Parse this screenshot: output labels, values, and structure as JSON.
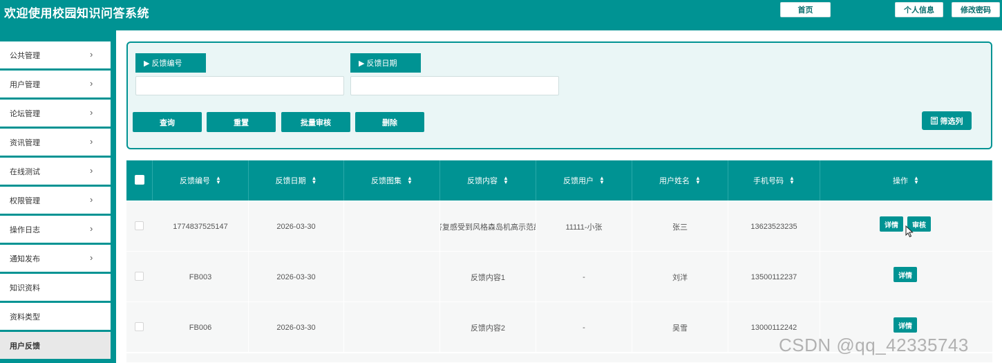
{
  "header": {
    "title": "欢迎使用校园知识问答系统",
    "home_label": "首页",
    "profile_label": "个人信息",
    "password_label": "修改密码"
  },
  "sidebar": {
    "items": [
      {
        "label": "公共管理",
        "has_arrow": true
      },
      {
        "label": "用户管理",
        "has_arrow": true
      },
      {
        "label": "论坛管理",
        "has_arrow": true
      },
      {
        "label": "资讯管理",
        "has_arrow": true
      },
      {
        "label": "在线测试",
        "has_arrow": true
      },
      {
        "label": "权限管理",
        "has_arrow": true
      },
      {
        "label": "操作日志",
        "has_arrow": true
      },
      {
        "label": "通知发布",
        "has_arrow": true
      },
      {
        "label": "知识资料",
        "has_arrow": false
      },
      {
        "label": "资料类型",
        "has_arrow": false
      },
      {
        "label": "用户反馈",
        "has_arrow": false,
        "active": true
      }
    ]
  },
  "search": {
    "fields": [
      {
        "label": "▶ 反馈编号",
        "value": ""
      },
      {
        "label": "▶ 反馈日期",
        "value": ""
      }
    ],
    "buttons": {
      "query": "查询",
      "reset": "重置",
      "batch_review": "批量审核",
      "delete": "删除"
    },
    "filter_label": "筛选列"
  },
  "table": {
    "columns": [
      "反馈编号",
      "反馈日期",
      "反馈图集",
      "反馈内容",
      "反馈用户",
      "用户姓名",
      "手机号码",
      "操作"
    ],
    "rows": [
      {
        "id": "1774837525147",
        "date": "2026-03-30",
        "images": "",
        "content": "答复感受到风格森岛机高示范故",
        "user": "11111-小张",
        "name": "张三",
        "phone": "13623523235",
        "actions": [
          "详情",
          "审核"
        ]
      },
      {
        "id": "FB003",
        "date": "2026-03-30",
        "images": "",
        "content": "反馈内容1",
        "user": "-",
        "name": "刘洋",
        "phone": "13500112237",
        "actions": [
          "详情"
        ]
      },
      {
        "id": "FB006",
        "date": "2026-03-30",
        "images": "",
        "content": "反馈内容2",
        "user": "-",
        "name": "吴雪",
        "phone": "13000112242",
        "actions": [
          "详情"
        ]
      }
    ]
  },
  "watermark": "CSDN @qq_42335743",
  "colors": {
    "primary": "#009393",
    "panel_bg": "#eaf6f6",
    "row_bg": "#f6f7f7"
  }
}
